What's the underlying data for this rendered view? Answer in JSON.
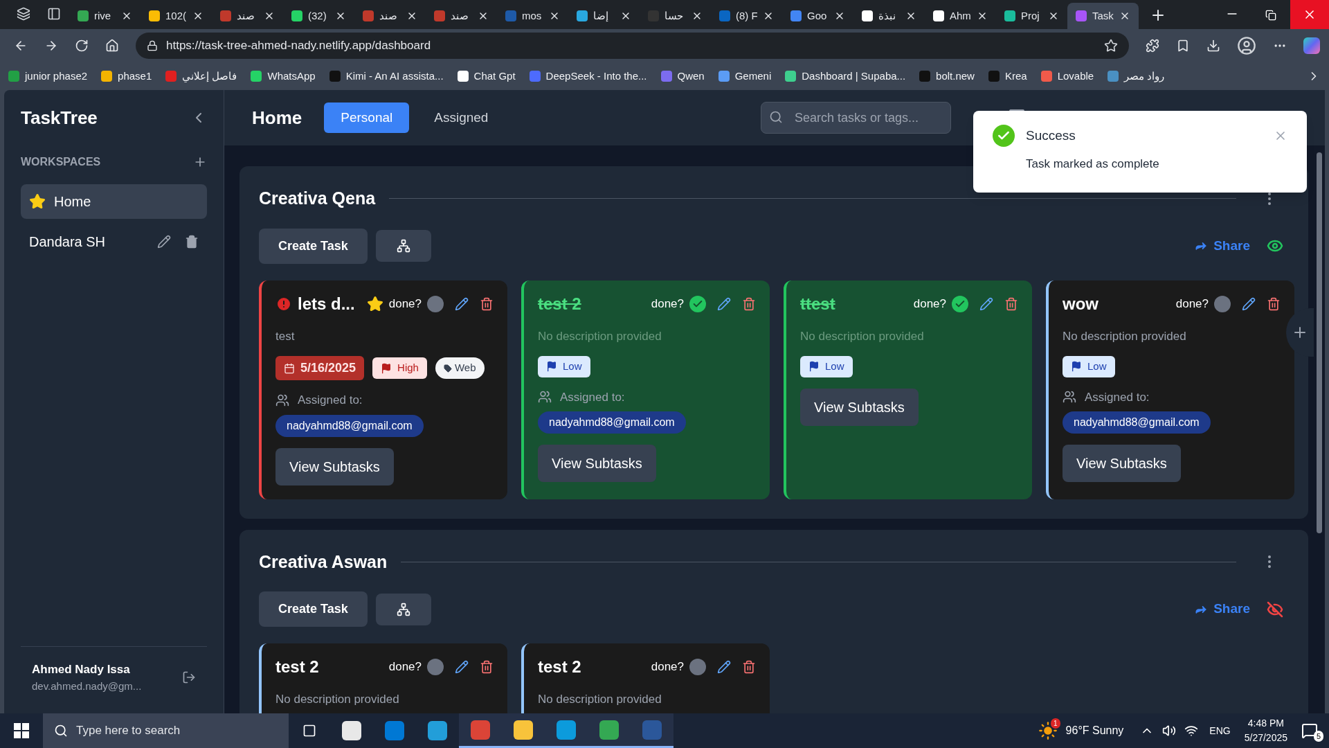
{
  "browser": {
    "tabs": [
      {
        "label": "rive",
        "selected": false,
        "color": "#34a853"
      },
      {
        "label": "102(",
        "selected": false,
        "color": "#fbbc04"
      },
      {
        "label": "صند",
        "selected": false,
        "color": "#c0392b"
      },
      {
        "label": "(32)",
        "selected": false,
        "color": "#25d366"
      },
      {
        "label": "صند",
        "selected": false,
        "color": "#c0392b"
      },
      {
        "label": "صند",
        "selected": false,
        "color": "#c0392b"
      },
      {
        "label": "mos",
        "selected": false,
        "color": "#1e5aa8"
      },
      {
        "label": "إضا",
        "selected": false,
        "color": "#29a8e0"
      },
      {
        "label": "حسا",
        "selected": false,
        "color": "#333333"
      },
      {
        "label": "(8) F",
        "selected": false,
        "color": "#0a66c2"
      },
      {
        "label": "Goo",
        "selected": false,
        "color": "#4285f4"
      },
      {
        "label": "نبذة",
        "selected": false,
        "color": "#ffffff"
      },
      {
        "label": "Ahm",
        "selected": false,
        "color": "#ffffff"
      },
      {
        "label": "Proj",
        "selected": false,
        "color": "#1abc9c"
      },
      {
        "label": "Task",
        "selected": true,
        "color": "#a855f7"
      }
    ],
    "url": "https://task-tree-ahmed-nady.netlify.app/dashboard",
    "bookmarks": [
      {
        "label": "junior phase2",
        "color": "#22a045"
      },
      {
        "label": "phase1",
        "color": "#f4b400"
      },
      {
        "label": "فاصل إعلاني",
        "color": "#e02020"
      },
      {
        "label": "WhatsApp",
        "color": "#25d366"
      },
      {
        "label": "Kimi - An AI assista...",
        "color": "#111111"
      },
      {
        "label": "Chat Gpt",
        "color": "#ffffff"
      },
      {
        "label": "DeepSeek - Into the...",
        "color": "#4d6bfe"
      },
      {
        "label": "Qwen",
        "color": "#7c6cf0"
      },
      {
        "label": "Gemeni",
        "color": "#5b9cf5"
      },
      {
        "label": "Dashboard | Supaba...",
        "color": "#3ecf8e"
      },
      {
        "label": "bolt.new",
        "color": "#111111"
      },
      {
        "label": "Krea",
        "color": "#111111"
      },
      {
        "label": "Lovable",
        "color": "#f05a4a"
      },
      {
        "label": "رواد مصر",
        "color": "#4a90c2"
      }
    ]
  },
  "sidebar": {
    "title": "TaskTree",
    "section": "WORKSPACES",
    "items": [
      {
        "label": "Home",
        "selected": true,
        "kind": "home"
      },
      {
        "label": "Dandara SH",
        "selected": false,
        "kind": "workspace"
      }
    ],
    "user": {
      "name": "Ahmed Nady Issa",
      "email": "dev.ahmed.nady@gm..."
    }
  },
  "header": {
    "title": "Home",
    "tabs": [
      {
        "label": "Personal",
        "selected": true
      },
      {
        "label": "Assigned",
        "selected": false
      }
    ],
    "search": {
      "placeholder": "Search tasks or tags..."
    }
  },
  "toast": {
    "title": "Success",
    "message": "Task marked as complete"
  },
  "workspaces": [
    {
      "name": "Creativa Qena",
      "create_label": "Create Task",
      "share_label": "Share",
      "visible": true,
      "tasks": [
        {
          "title": "lets d...",
          "done_label": "done?",
          "done": false,
          "starred": true,
          "description": "test",
          "date": "5/16/2025",
          "priority": {
            "label": "High",
            "kind": "high"
          },
          "tag": "Web",
          "assigned_label": "Assigned to:",
          "assignee": "nadyahmd88@gmail.com",
          "subtasks_label": "View Subtasks"
        },
        {
          "title": "test 2",
          "done_label": "done?",
          "done": true,
          "starred": false,
          "description": "No description provided",
          "priority": {
            "label": "Low",
            "kind": "low"
          },
          "assigned_label": "Assigned to:",
          "assignee": "nadyahmd88@gmail.com",
          "subtasks_label": "View Subtasks"
        },
        {
          "title": "ttest",
          "done_label": "done?",
          "done": true,
          "starred": false,
          "description": "No description provided",
          "priority": {
            "label": "Low",
            "kind": "low"
          },
          "subtasks_label": "View Subtasks"
        },
        {
          "title": "wow",
          "done_label": "done?",
          "done": false,
          "starred": false,
          "description": "No description provided",
          "priority": {
            "label": "Low",
            "kind": "low"
          },
          "assigned_label": "Assigned to:",
          "assignee": "nadyahmd88@gmail.com",
          "subtasks_label": "View Subtasks"
        }
      ]
    },
    {
      "name": "Creativa Aswan",
      "create_label": "Create Task",
      "share_label": "Share",
      "visible": false,
      "tasks": [
        {
          "title": "test 2",
          "done_label": "done?",
          "done": false,
          "starred": false,
          "description": "No description provided"
        },
        {
          "title": "test 2",
          "done_label": "done?",
          "done": false,
          "starred": false,
          "description": "No description provided"
        }
      ]
    }
  ],
  "taskbar": {
    "search_placeholder": "Type here to search",
    "apps": [
      {
        "color": "#e8e8e8",
        "selected": false
      },
      {
        "color": "#0078d4",
        "selected": false
      },
      {
        "color": "#229ed9",
        "selected": false
      },
      {
        "color": "#db4437",
        "selected": true
      },
      {
        "color": "#f8c33b",
        "selected": true
      },
      {
        "color": "#0c9bdc",
        "selected": true
      },
      {
        "color": "#34a853",
        "selected": true
      },
      {
        "color": "#2b579a",
        "selected": true
      }
    ],
    "weather_badge": "1",
    "weather": "96°F Sunny",
    "language": "ENG",
    "time": "4:48 PM",
    "date": "5/27/2025",
    "notifications": "5"
  }
}
